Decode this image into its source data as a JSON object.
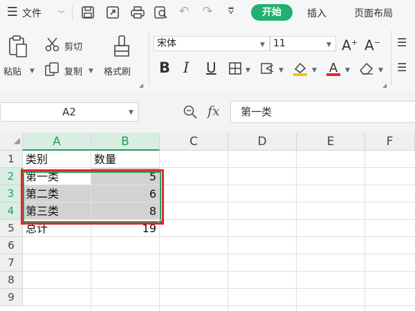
{
  "menu": {
    "file_label": "文件",
    "tabs": [
      {
        "label": "开始",
        "active": true
      },
      {
        "label": "插入",
        "active": false
      },
      {
        "label": "页面布局",
        "active": false
      }
    ]
  },
  "ribbon": {
    "paste_label": "粘贴",
    "cut_label": "剪切",
    "copy_label": "复制",
    "format_painter_label": "格式刷",
    "font_name": "宋体",
    "font_size": "11"
  },
  "formula_bar": {
    "name_box": "A2",
    "fx_label": "fx",
    "content": "第一类"
  },
  "sheet": {
    "columns": [
      "A",
      "B",
      "C",
      "D",
      "E",
      "F"
    ],
    "rows": [
      "1",
      "2",
      "3",
      "4",
      "5",
      "6",
      "7",
      "8",
      "9"
    ],
    "cells": [
      [
        "类别",
        "数量"
      ],
      [
        "第一类",
        "5"
      ],
      [
        "第二类",
        "6"
      ],
      [
        "第三类",
        "8"
      ],
      [
        "总计",
        "19"
      ]
    ]
  },
  "colors": {
    "accent_green": "#1e9e60",
    "start_tab_bg": "#20b070",
    "highlight_red": "#e3262b",
    "selection_gray": "#d3d3d3"
  }
}
